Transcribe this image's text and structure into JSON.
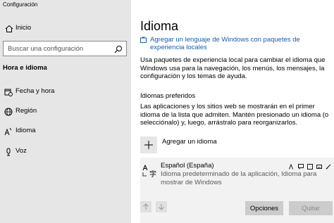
{
  "window": {
    "title": "Configuración"
  },
  "sidebar": {
    "home_label": "Inicio",
    "search_placeholder": "Buscar una configuración",
    "section_title": "Hora e idioma",
    "items": [
      {
        "label": "Fecha y hora",
        "icon": "calendar-clock-icon"
      },
      {
        "label": "Región",
        "icon": "globe-icon"
      },
      {
        "label": "Idioma",
        "icon": "language-icon"
      },
      {
        "label": "Voz",
        "icon": "microphone-icon"
      }
    ]
  },
  "main": {
    "title": "Idioma",
    "link": "Agregar un lenguaje de Windows con paquetes de experiencia locales",
    "description": "Usa paquetes de experiencia local para cambiar el idioma que Windows usa para la navegación, los menús, los mensajes, la configuración y los temas de ayuda.",
    "preferred_title": "Idiomas preferidos",
    "preferred_description": "Las aplicaciones y los sitios web se mostrarán en el primer idioma de la lista que admiten. Mantén presionado un idioma (o selecciónalo) y, luego, arrástralo para reorganizarlos.",
    "add_language_label": "Agregar un idioma",
    "language": {
      "name": "Español (España)",
      "description": "Idioma predeterminado de la aplicación, Idioma para mostrar de Windows",
      "options_label": "Opciones",
      "remove_label": "Quitar"
    }
  }
}
